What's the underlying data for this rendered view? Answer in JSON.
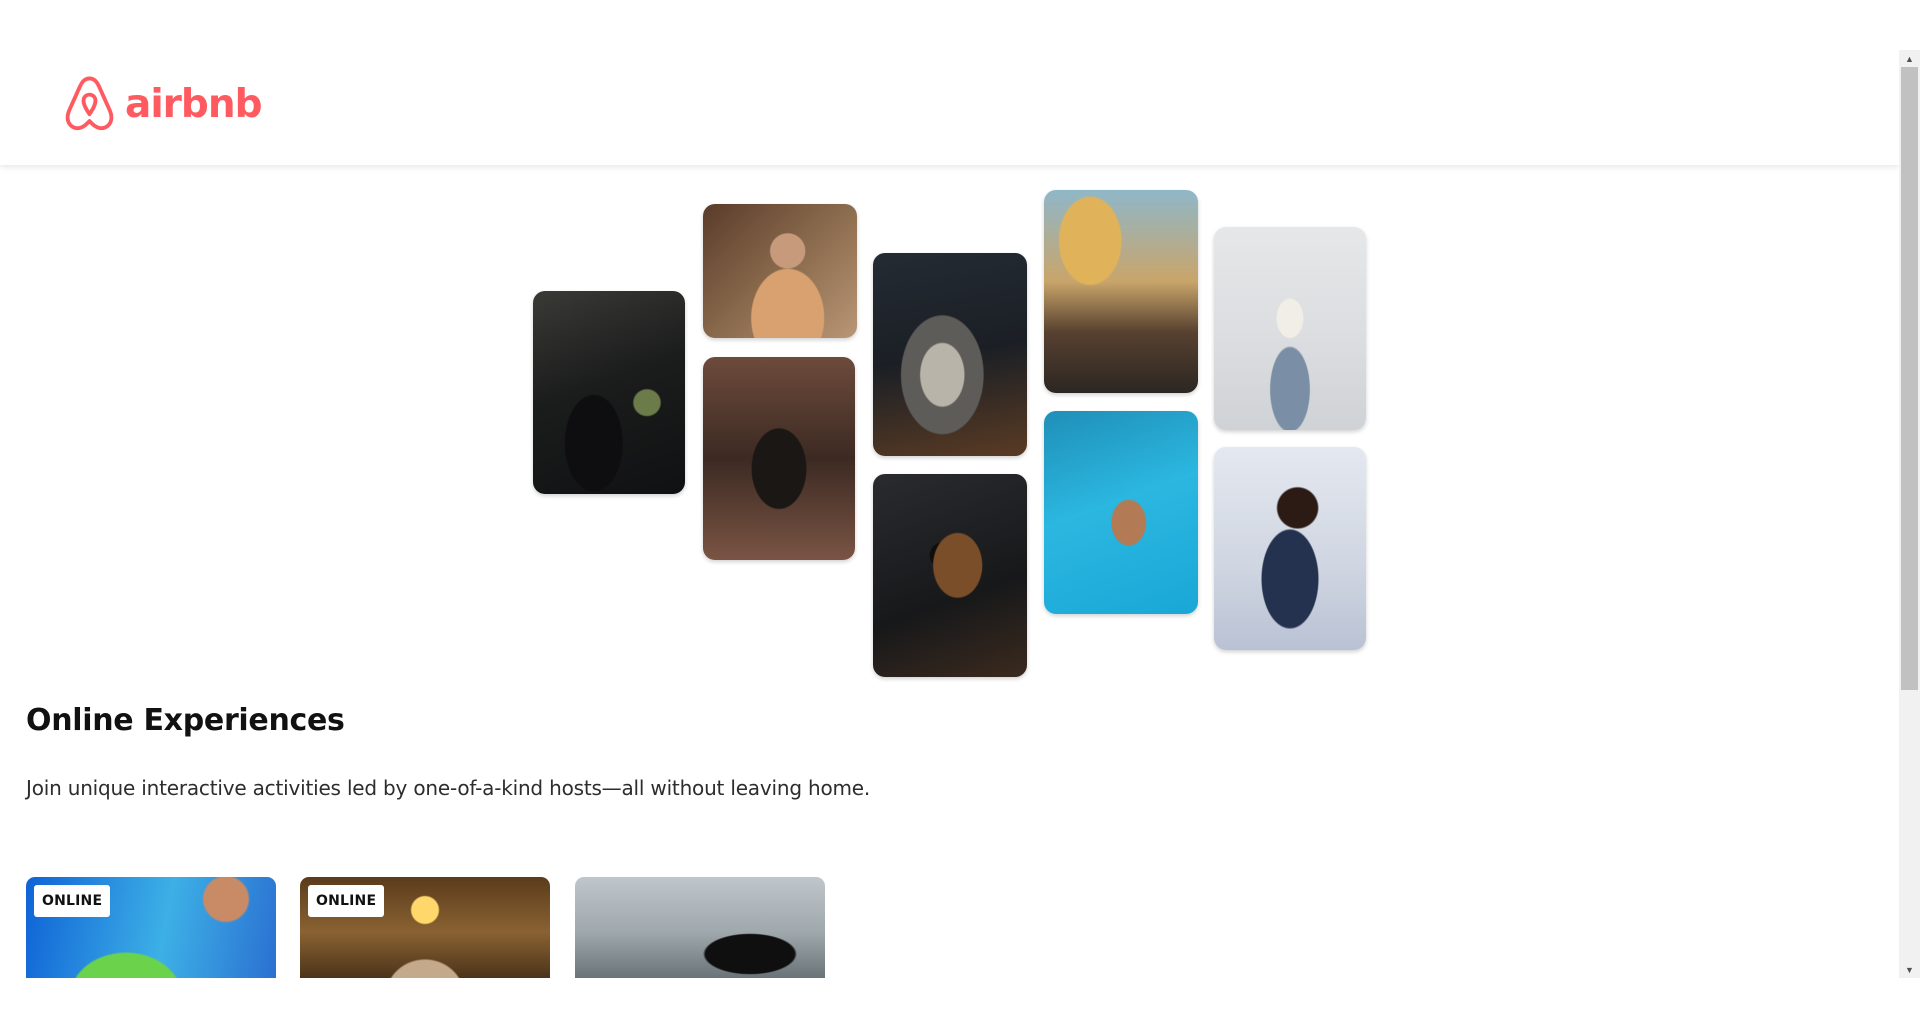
{
  "brand": {
    "name": "airbnb",
    "color": "#ff5a5f"
  },
  "hero": {
    "photos": [
      {
        "name": "cooking-photo"
      },
      {
        "name": "host-portrait-photo"
      },
      {
        "name": "dancer-doorway-photo"
      },
      {
        "name": "food-bowl-photo"
      },
      {
        "name": "guitar-photo"
      },
      {
        "name": "piano-microphone-photo"
      },
      {
        "name": "swimmer-photo"
      },
      {
        "name": "yoga-photo"
      },
      {
        "name": "singer-photo"
      }
    ]
  },
  "section": {
    "title": "Online Experiences",
    "description": "Join unique interactive activities led by one-of-a-kind hosts—all without leaving home."
  },
  "cards": [
    {
      "badge": "ONLINE"
    },
    {
      "badge": "ONLINE"
    },
    {
      "badge": ""
    }
  ],
  "colors": {
    "background": "#ffffff",
    "text": "#111111",
    "scrollbar_track": "#f1f1f1",
    "scrollbar_thumb": "#c1c1c1"
  }
}
